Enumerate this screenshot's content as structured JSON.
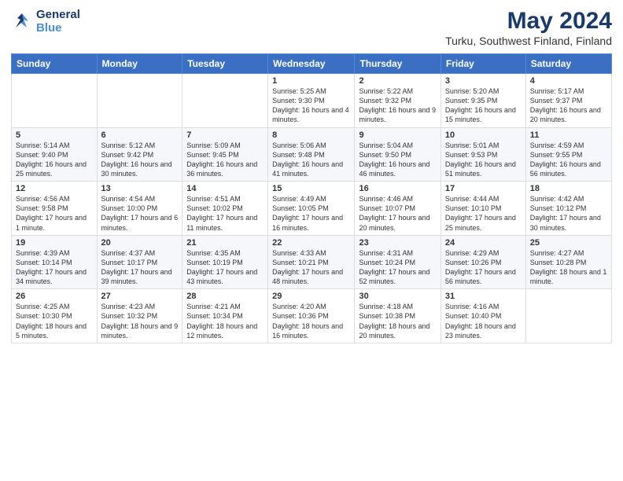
{
  "logo": {
    "line1": "General",
    "line2": "Blue"
  },
  "title": "May 2024",
  "subtitle": "Turku, Southwest Finland, Finland",
  "weekdays": [
    "Sunday",
    "Monday",
    "Tuesday",
    "Wednesday",
    "Thursday",
    "Friday",
    "Saturday"
  ],
  "weeks": [
    [
      {
        "day": "",
        "info": ""
      },
      {
        "day": "",
        "info": ""
      },
      {
        "day": "",
        "info": ""
      },
      {
        "day": "1",
        "info": "Sunrise: 5:25 AM\nSunset: 9:30 PM\nDaylight: 16 hours and 4 minutes."
      },
      {
        "day": "2",
        "info": "Sunrise: 5:22 AM\nSunset: 9:32 PM\nDaylight: 16 hours and 9 minutes."
      },
      {
        "day": "3",
        "info": "Sunrise: 5:20 AM\nSunset: 9:35 PM\nDaylight: 16 hours and 15 minutes."
      },
      {
        "day": "4",
        "info": "Sunrise: 5:17 AM\nSunset: 9:37 PM\nDaylight: 16 hours and 20 minutes."
      }
    ],
    [
      {
        "day": "5",
        "info": "Sunrise: 5:14 AM\nSunset: 9:40 PM\nDaylight: 16 hours and 25 minutes."
      },
      {
        "day": "6",
        "info": "Sunrise: 5:12 AM\nSunset: 9:42 PM\nDaylight: 16 hours and 30 minutes."
      },
      {
        "day": "7",
        "info": "Sunrise: 5:09 AM\nSunset: 9:45 PM\nDaylight: 16 hours and 36 minutes."
      },
      {
        "day": "8",
        "info": "Sunrise: 5:06 AM\nSunset: 9:48 PM\nDaylight: 16 hours and 41 minutes."
      },
      {
        "day": "9",
        "info": "Sunrise: 5:04 AM\nSunset: 9:50 PM\nDaylight: 16 hours and 46 minutes."
      },
      {
        "day": "10",
        "info": "Sunrise: 5:01 AM\nSunset: 9:53 PM\nDaylight: 16 hours and 51 minutes."
      },
      {
        "day": "11",
        "info": "Sunrise: 4:59 AM\nSunset: 9:55 PM\nDaylight: 16 hours and 56 minutes."
      }
    ],
    [
      {
        "day": "12",
        "info": "Sunrise: 4:56 AM\nSunset: 9:58 PM\nDaylight: 17 hours and 1 minute."
      },
      {
        "day": "13",
        "info": "Sunrise: 4:54 AM\nSunset: 10:00 PM\nDaylight: 17 hours and 6 minutes."
      },
      {
        "day": "14",
        "info": "Sunrise: 4:51 AM\nSunset: 10:02 PM\nDaylight: 17 hours and 11 minutes."
      },
      {
        "day": "15",
        "info": "Sunrise: 4:49 AM\nSunset: 10:05 PM\nDaylight: 17 hours and 16 minutes."
      },
      {
        "day": "16",
        "info": "Sunrise: 4:46 AM\nSunset: 10:07 PM\nDaylight: 17 hours and 20 minutes."
      },
      {
        "day": "17",
        "info": "Sunrise: 4:44 AM\nSunset: 10:10 PM\nDaylight: 17 hours and 25 minutes."
      },
      {
        "day": "18",
        "info": "Sunrise: 4:42 AM\nSunset: 10:12 PM\nDaylight: 17 hours and 30 minutes."
      }
    ],
    [
      {
        "day": "19",
        "info": "Sunrise: 4:39 AM\nSunset: 10:14 PM\nDaylight: 17 hours and 34 minutes."
      },
      {
        "day": "20",
        "info": "Sunrise: 4:37 AM\nSunset: 10:17 PM\nDaylight: 17 hours and 39 minutes."
      },
      {
        "day": "21",
        "info": "Sunrise: 4:35 AM\nSunset: 10:19 PM\nDaylight: 17 hours and 43 minutes."
      },
      {
        "day": "22",
        "info": "Sunrise: 4:33 AM\nSunset: 10:21 PM\nDaylight: 17 hours and 48 minutes."
      },
      {
        "day": "23",
        "info": "Sunrise: 4:31 AM\nSunset: 10:24 PM\nDaylight: 17 hours and 52 minutes."
      },
      {
        "day": "24",
        "info": "Sunrise: 4:29 AM\nSunset: 10:26 PM\nDaylight: 17 hours and 56 minutes."
      },
      {
        "day": "25",
        "info": "Sunrise: 4:27 AM\nSunset: 10:28 PM\nDaylight: 18 hours and 1 minute."
      }
    ],
    [
      {
        "day": "26",
        "info": "Sunrise: 4:25 AM\nSunset: 10:30 PM\nDaylight: 18 hours and 5 minutes."
      },
      {
        "day": "27",
        "info": "Sunrise: 4:23 AM\nSunset: 10:32 PM\nDaylight: 18 hours and 9 minutes."
      },
      {
        "day": "28",
        "info": "Sunrise: 4:21 AM\nSunset: 10:34 PM\nDaylight: 18 hours and 12 minutes."
      },
      {
        "day": "29",
        "info": "Sunrise: 4:20 AM\nSunset: 10:36 PM\nDaylight: 18 hours and 16 minutes."
      },
      {
        "day": "30",
        "info": "Sunrise: 4:18 AM\nSunset: 10:38 PM\nDaylight: 18 hours and 20 minutes."
      },
      {
        "day": "31",
        "info": "Sunrise: 4:16 AM\nSunset: 10:40 PM\nDaylight: 18 hours and 23 minutes."
      },
      {
        "day": "",
        "info": ""
      }
    ]
  ]
}
